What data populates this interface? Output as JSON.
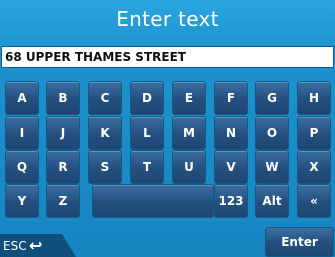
{
  "title": "Enter text",
  "field": {
    "value": "68 UPPER THAMES STREET"
  },
  "keyboard": {
    "rows": [
      [
        "A",
        "B",
        "C",
        "D",
        "E",
        "F",
        "G",
        "H"
      ],
      [
        "I",
        "J",
        "K",
        "L",
        "M",
        "N",
        "O",
        "P"
      ],
      [
        "Q",
        "R",
        "S",
        "T",
        "U",
        "V",
        "W",
        "X"
      ],
      [
        "Y",
        "Z"
      ]
    ],
    "space_label": "",
    "numeric_label": "123",
    "alt_label": "Alt",
    "backspace_label": "«"
  },
  "esc": {
    "label": "ESC",
    "icon": "back-arrow-icon",
    "glyph": "↩"
  },
  "enter": {
    "label": "Enter"
  }
}
